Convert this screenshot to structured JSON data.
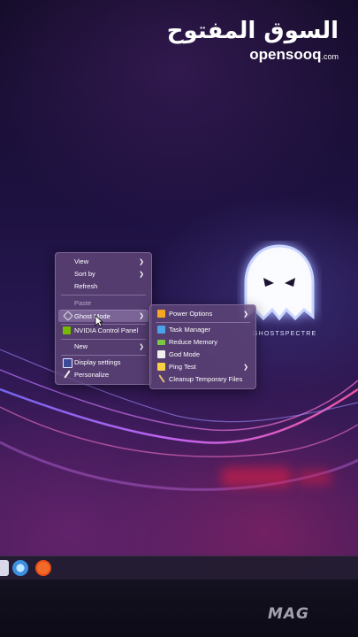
{
  "watermark": {
    "arabic": "السوق المفتوح",
    "site": "opensooq",
    "tld": ".com"
  },
  "wallpaper": {
    "logo_text": "GHOSTSPECTRE"
  },
  "context_menu": {
    "items": [
      {
        "label": "View",
        "has_submenu": true
      },
      {
        "label": "Sort by",
        "has_submenu": true
      },
      {
        "label": "Refresh",
        "has_submenu": false
      },
      {
        "label": "Paste",
        "has_submenu": false,
        "disabled": true
      },
      {
        "label": "Ghost Mode",
        "has_submenu": true,
        "highlighted": true
      },
      {
        "label": "NVIDIA Control Panel",
        "has_submenu": false
      },
      {
        "label": "New",
        "has_submenu": true
      },
      {
        "label": "Display settings",
        "has_submenu": false
      },
      {
        "label": "Personalize",
        "has_submenu": false
      }
    ]
  },
  "ghost_submenu": {
    "items": [
      {
        "label": "Power Options",
        "has_submenu": true,
        "icon": "power-icon"
      },
      {
        "label": "Task Manager",
        "has_submenu": false,
        "icon": "task-manager-icon"
      },
      {
        "label": "Reduce Memory",
        "has_submenu": false,
        "icon": "memory-icon"
      },
      {
        "label": "God Mode",
        "has_submenu": false,
        "icon": "god-mode-icon"
      },
      {
        "label": "Ping Test",
        "has_submenu": true,
        "icon": "ping-icon"
      },
      {
        "label": "Cleanup Temporary Files",
        "has_submenu": false,
        "icon": "broom-icon"
      }
    ]
  },
  "monitor": {
    "brand": "MAG"
  },
  "colors": {
    "menu_bg": "#5f4678",
    "highlight": "#aa96c8",
    "ghost_glow": "#c9d4ff"
  }
}
